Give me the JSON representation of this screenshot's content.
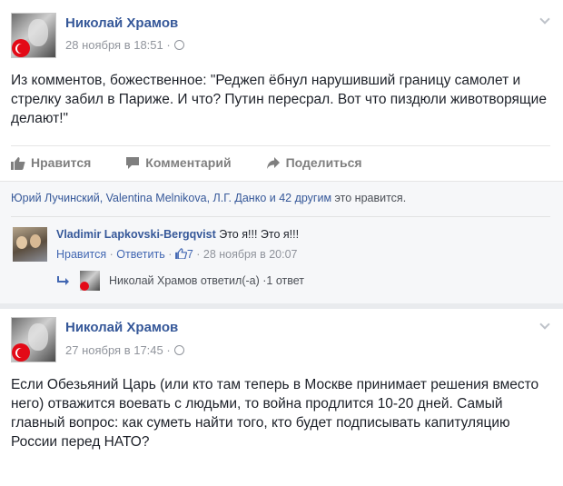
{
  "post1": {
    "author": "Николай Храмов",
    "time": "28 ноября в 18:51 ·",
    "text": "Из комментов, божественное: \"Реджеп ёбнул нарушивший границу самолет и стрелку забил в Париже. И что? Путин пересрал. Вот что пиздюли животворящие делают!\"",
    "actions": {
      "like": "Нравится",
      "comment": "Комментарий",
      "share": "Поделиться"
    },
    "likes_line": {
      "names": "Юрий Лучинский, Valentina Melnikova, Л.Г. Данко и 42 другим",
      "suffix": " это нравится."
    },
    "comment": {
      "author": "Vladimir Lapkovski-Bergqvist",
      "text": " Это я!!! Это я!!!",
      "like": "Нравится",
      "sep1": " · ",
      "reply": "Ответить",
      "sep2": " · ",
      "like_count": "7",
      "time": " · 28 ноября в 20:07"
    },
    "reply_summary": {
      "text": "Николай Храмов ответил(-а) · ",
      "count": "1 ответ"
    }
  },
  "post2": {
    "author": "Николай Храмов",
    "time": "27 ноября в 17:45 ·",
    "text": "Если Обезьяний Царь (или кто там теперь в Москве принимает решения вместо него) отважится воевать с людьми, то война продлится 10-20 дней. Самый главный вопрос: как суметь найти того, кто будет подписывать капитуляцию России перед НАТО?"
  },
  "colors": {
    "link": "#365899",
    "meta": "#90949c",
    "text": "#1d2129",
    "flag": "#e30a17"
  },
  "icons": [
    "thumbs-up-icon",
    "comment-icon",
    "share-icon",
    "globe-icon",
    "chevron-down-icon",
    "reply-arrow-icon"
  ]
}
